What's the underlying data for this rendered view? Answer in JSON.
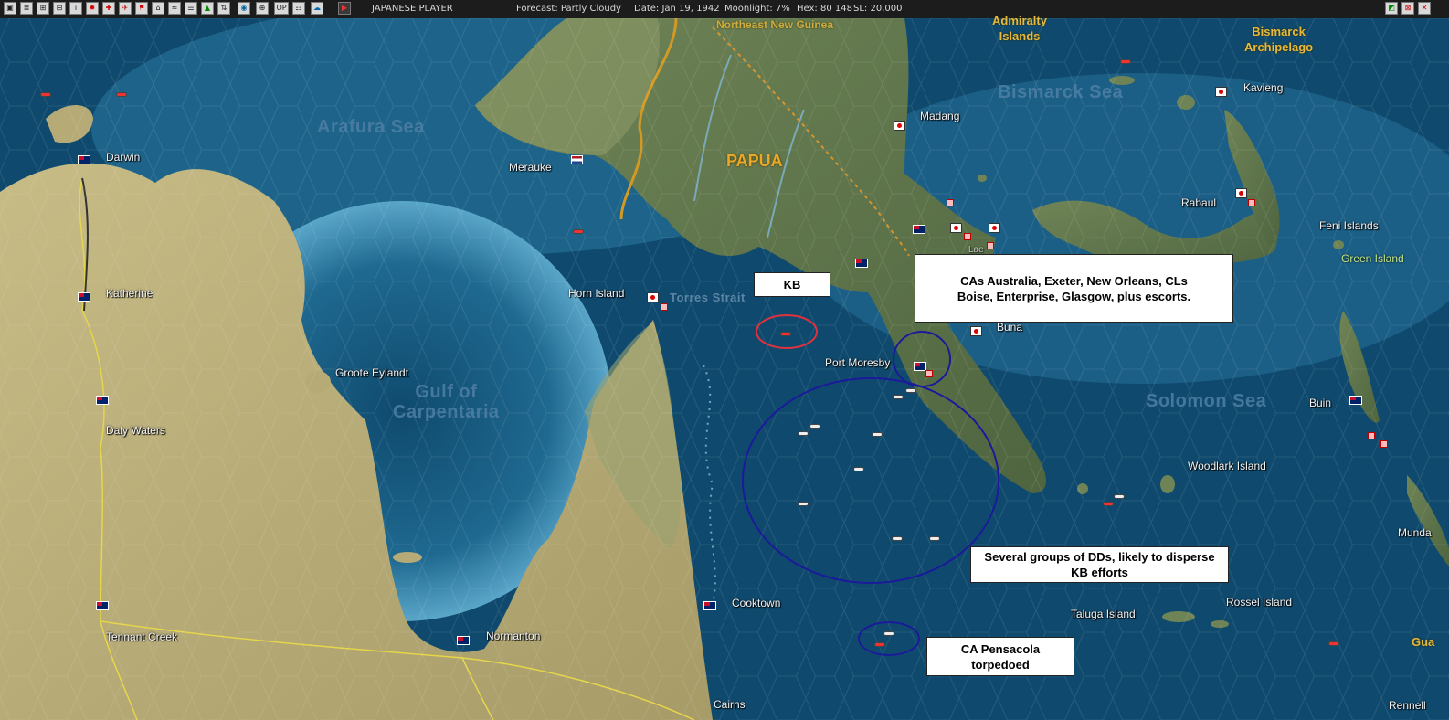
{
  "topbar": {
    "player": "JAPANESE PLAYER",
    "forecast": "Forecast: Partly Cloudy",
    "date": "Date: Jan 19, 1942",
    "moonlight": "Moonlight: 7%",
    "hex": "Hex: 80 148",
    "sl": "SL: 20,000",
    "op_label": "OP",
    "icons": [
      "info-icon",
      "list-icon",
      "group-icon",
      "ships-icon",
      "alert-icon",
      "sun-icon",
      "aircraft-icon",
      "flag-icon",
      "base-icon",
      "reports-icon",
      "map-icon",
      "globe-icon",
      "settings-icon",
      "op-icon",
      "menu-icon",
      "cloud-icon",
      "play-icon"
    ]
  },
  "map": {
    "colors": {
      "sea_deep": "#0f4a6e",
      "sea_shallow": "#5aa6c9",
      "land": "#b9ad7a",
      "jungle": "#5f7447"
    },
    "sea_labels": [
      {
        "id": "arafura",
        "text": "Arafura Sea"
      },
      {
        "id": "carpentaria",
        "text": "Gulf of\nCarpentaria"
      },
      {
        "id": "bismarck",
        "text": "Bismarck Sea"
      },
      {
        "id": "solomon",
        "text": "Solomon Sea"
      }
    ],
    "region_labels": {
      "papua": "PAPUA",
      "admiralty": "Admiralty\nIslands",
      "bismarck_arch": "Bismarck\nArchipelago",
      "northeast_ng": "Northeast New Guinea",
      "green_island": "Green Island",
      "torres": "Torres Strait"
    },
    "places": [
      {
        "id": "darwin",
        "text": "Darwin"
      },
      {
        "id": "katherine",
        "text": "Katherine"
      },
      {
        "id": "groote",
        "text": "Groote Eylandt"
      },
      {
        "id": "daly",
        "text": "Daly Waters"
      },
      {
        "id": "tennant",
        "text": "Tennant Creek"
      },
      {
        "id": "normanton",
        "text": "Normanton"
      },
      {
        "id": "cooktown",
        "text": "Cooktown"
      },
      {
        "id": "cairns",
        "text": "Cairns"
      },
      {
        "id": "merauke",
        "text": "Merauke"
      },
      {
        "id": "horn",
        "text": "Horn Island"
      },
      {
        "id": "moresby",
        "text": "Port Moresby"
      },
      {
        "id": "madang",
        "text": "Madang"
      },
      {
        "id": "buna",
        "text": "Buna"
      },
      {
        "id": "kavieng",
        "text": "Kavieng"
      },
      {
        "id": "rabaul",
        "text": "Rabaul"
      },
      {
        "id": "feni",
        "text": "Feni Islands"
      },
      {
        "id": "buin",
        "text": "Buin"
      },
      {
        "id": "woodlark",
        "text": "Woodlark Island"
      },
      {
        "id": "taluga",
        "text": "Taluga Island"
      },
      {
        "id": "rossel",
        "text": "Rossel Island"
      },
      {
        "id": "munda",
        "text": "Munda"
      },
      {
        "id": "rennell",
        "text": "Rennell"
      },
      {
        "id": "gua",
        "text": "Gua"
      },
      {
        "id": "lae",
        "text": "Lae"
      }
    ],
    "annotations": {
      "kb": "KB",
      "cruisers": "CAs Australia, Exeter, New Orleans, CLs Boise, Enterprise, Glasgow, plus escorts.",
      "dds": "Several groups of DDs, likely to disperse KB efforts",
      "pensacola": "CA Pensacola torpedoed"
    }
  }
}
